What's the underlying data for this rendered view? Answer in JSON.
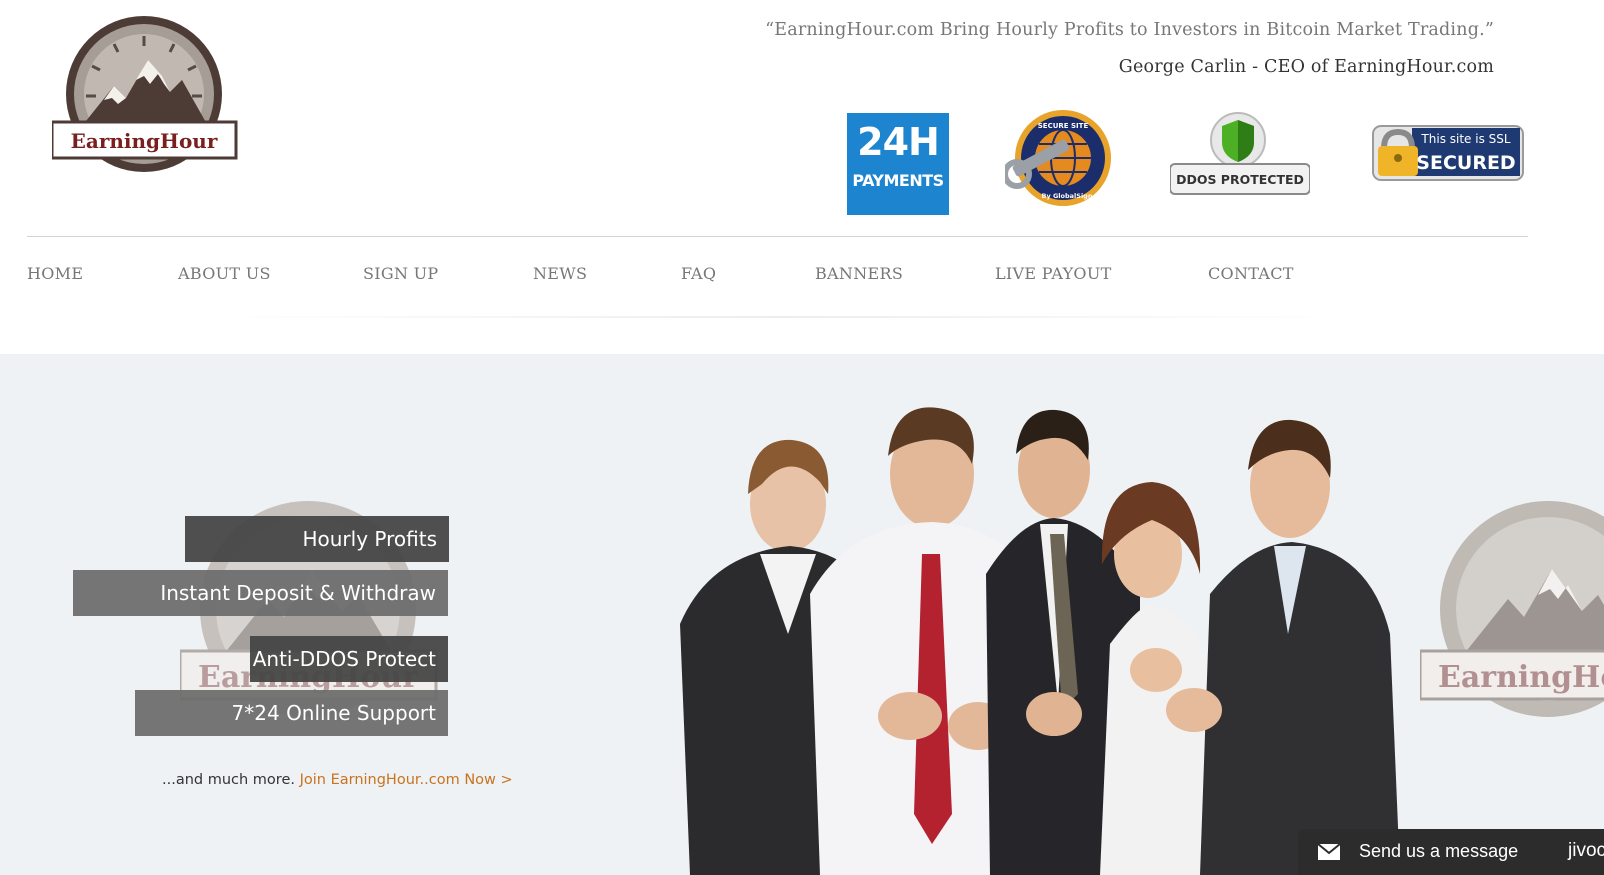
{
  "header": {
    "logo_text": "EarningHour",
    "quote": "“EarningHour.com Bring Hourly Profits to Investors in Bitcoin Market Trading.”",
    "author": "George Carlin - CEO of EarningHour.com"
  },
  "badges": {
    "payments_big": "24H",
    "payments_small": "PAYMENTS",
    "secure_site_top": "SECURE SITE",
    "secure_site_bottom": "By GlobalSign",
    "ddos": "DDOS PROTECTED",
    "ssl_top": "This site is SSL",
    "ssl_bottom": "SECURED"
  },
  "nav": [
    {
      "label": "HOME"
    },
    {
      "label": "ABOUT US"
    },
    {
      "label": "SIGN UP"
    },
    {
      "label": "NEWS"
    },
    {
      "label": "FAQ"
    },
    {
      "label": "BANNERS"
    },
    {
      "label": "LIVE PAYOUT"
    },
    {
      "label": "CONTACT"
    }
  ],
  "hero": {
    "features": [
      "Hourly Profits",
      "Instant Deposit & Withdraw",
      "Anti-DDOS Protect",
      "7*24 Online Support"
    ],
    "more_text": "...and much more.",
    "join_link": "Join EarningHour..com Now >",
    "watermark_text": "EarningHour"
  },
  "chat": {
    "label": "Send us a message",
    "brand": "jivoc"
  },
  "colors": {
    "accent": "#c8731f",
    "logo_red": "#7a1f1f",
    "payments_blue": "#1d84d0",
    "hero_bg": "#eef2f5",
    "chat_bg": "#2c2c2c"
  }
}
